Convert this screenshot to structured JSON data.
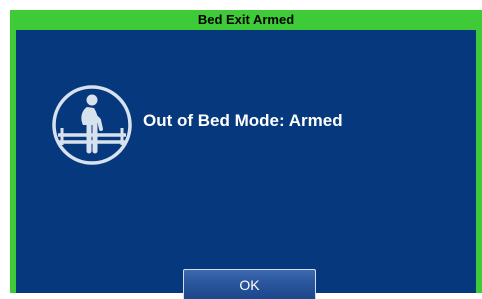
{
  "dialog": {
    "title": "Bed Exit Armed",
    "message": "Out of Bed Mode: Armed",
    "icon": "bed-exit-icon",
    "ok_label": "OK"
  },
  "colors": {
    "title_bar": "#3ecb37",
    "content_background": "#06387d",
    "text": "#ffffff",
    "title_text": "#000000",
    "button": "#2a559c"
  }
}
